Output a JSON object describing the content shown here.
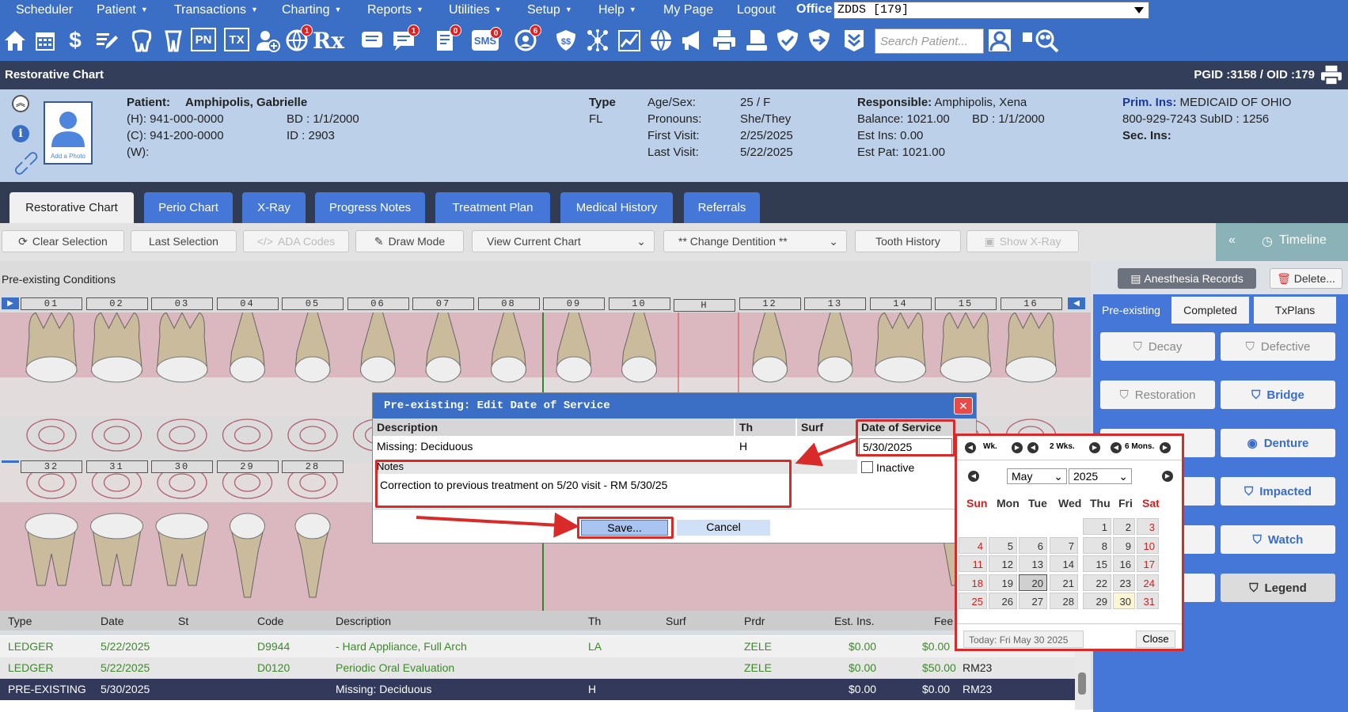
{
  "menu": [
    {
      "label": "Scheduler",
      "dd": false
    },
    {
      "label": "Patient",
      "dd": true
    },
    {
      "label": "Transactions",
      "dd": true
    },
    {
      "label": "Charting",
      "dd": true
    },
    {
      "label": "Reports",
      "dd": true
    },
    {
      "label": "Utilities",
      "dd": true
    },
    {
      "label": "Setup",
      "dd": true
    },
    {
      "label": "Help",
      "dd": true
    },
    {
      "label": "My Page",
      "dd": false
    },
    {
      "label": "Logout",
      "dd": false
    }
  ],
  "office": {
    "label": "Office",
    "value": "ZDDS [179]"
  },
  "toolbar_icons": {
    "badges": {
      "globe": "1",
      "messages": "1",
      "clipboard": "0",
      "sms": "0",
      "recall": "6"
    },
    "pn": "PN",
    "tx": "TX",
    "rx": "Rx",
    "sms": "SMS"
  },
  "search": {
    "placeholder": "Search Patient..."
  },
  "title": {
    "left": "Restorative Chart",
    "right": "PGID :3158  /  OID :179"
  },
  "patient": {
    "label": "Patient:",
    "name": "Amphipolis, Gabrielle",
    "home": "(H):  941-000-0000",
    "cell": "(C):  941-200-0000",
    "work": "(W):",
    "bd": "BD  :  1/1/2000",
    "id": "ID  :  2903",
    "photo_caption": "Add a Photo",
    "type_label": "Type",
    "type_value": "FL",
    "age_label": "Age/Sex:",
    "age_value": "25 / F",
    "pronouns_label": "Pronouns:",
    "pronouns_value": "She/They",
    "first_label": "First Visit:",
    "first_value": "2/25/2025",
    "last_label": "Last Visit:",
    "last_value": "5/22/2025"
  },
  "responsible": {
    "label": "Responsible:",
    "name": "Amphipolis, Xena",
    "balance": "Balance:  1021.00",
    "bd": "BD  :  1/1/2000",
    "est_ins": "Est Ins:   0.00",
    "est_pat": "Est Pat:  1021.00"
  },
  "insurance": {
    "prim_label": "Prim. Ins:",
    "prim_value": "MEDICAID OF OHIO",
    "phone": "800-929-7243  SubID : 1256",
    "sec_label": "Sec. Ins:"
  },
  "tabs": [
    "Restorative Chart",
    "Perio Chart",
    "X-Ray",
    "Progress Notes",
    "Treatment Plan",
    "Medical History",
    "Referrals"
  ],
  "toolbar": {
    "clear": "Clear Selection",
    "last": "Last Selection",
    "ada": "ADA Codes",
    "draw": "Draw Mode",
    "view": "View Current Chart",
    "dent": "** Change Dentition **",
    "history": "Tooth History",
    "xray": "Show X-Ray",
    "timeline": "Timeline"
  },
  "chart": {
    "section": "Pre-existing Conditions",
    "upper": [
      "01",
      "02",
      "03",
      "04",
      "05",
      "06",
      "07",
      "08",
      "09",
      "10",
      "H",
      "12",
      "13",
      "14",
      "15",
      "16"
    ],
    "lower": [
      "32",
      "31",
      "30",
      "29",
      "28"
    ]
  },
  "right": {
    "anesthesia": "Anesthesia Records",
    "delete": "Delete...",
    "tabs": [
      "Pre-existing",
      "Completed",
      "TxPlans"
    ],
    "buttons": [
      "Decay",
      "Defective",
      "Restoration",
      "Bridge",
      "Denture",
      "Impacted",
      "Watch",
      "Legend"
    ]
  },
  "grid": {
    "headers": [
      "Type",
      "Date",
      "St",
      "Code",
      "Description",
      "Th",
      "Surf",
      "Prdr",
      "Est. Ins.",
      "Fee"
    ],
    "rows": [
      {
        "type": "LEDGER",
        "date": "5/22/2025",
        "st": "",
        "code": "D9944",
        "desc": "- Hard Appliance, Full Arch",
        "th": "LA",
        "surf": "",
        "prdr": "ZELE",
        "ins": "$0.00",
        "fee": "$0.00",
        "by": ""
      },
      {
        "type": "LEDGER",
        "date": "5/22/2025",
        "st": "",
        "code": "D0120",
        "desc": "Periodic Oral Evaluation",
        "th": "",
        "surf": "",
        "prdr": "ZELE",
        "ins": "$0.00",
        "fee": "$50.00",
        "by": "RM23"
      },
      {
        "type": "PRE-EXISTING",
        "date": "5/30/2025",
        "st": "",
        "code": "",
        "desc": "Missing: Deciduous",
        "th": "H",
        "surf": "",
        "prdr": "",
        "ins": "$0.00",
        "fee": "$0.00",
        "by": "RM23"
      }
    ]
  },
  "dialog": {
    "title": "Pre-existing: Edit Date of Service",
    "h_desc": "Description",
    "h_th": "Th",
    "h_surf": "Surf",
    "h_dos": "Date of Service",
    "desc": "Missing: Deciduous",
    "th": "H",
    "dos": "5/30/2025",
    "notes_label": "Notes",
    "notes": "Correction to previous treatment on 5/20 visit - RM 5/30/25",
    "inactive": "Inactive",
    "save": "Save...",
    "cancel": "Cancel"
  },
  "calendar": {
    "wk": "Wk.",
    "wk2": "2 Wks.",
    "mons": "6 Mons.",
    "month": "May",
    "year": "2025",
    "dows": [
      "Sun",
      "Mon",
      "Tue",
      "Wed",
      "Thu",
      "Fri",
      "Sat"
    ],
    "weeks": [
      [
        "",
        "",
        "",
        "",
        "1",
        "2",
        "3"
      ],
      [
        "4",
        "5",
        "6",
        "7",
        "8",
        "9",
        "10"
      ],
      [
        "11",
        "12",
        "13",
        "14",
        "15",
        "16",
        "17"
      ],
      [
        "18",
        "19",
        "20",
        "21",
        "22",
        "23",
        "24"
      ],
      [
        "25",
        "26",
        "27",
        "28",
        "29",
        "30",
        "31"
      ]
    ],
    "today": "Today: Fri May 30 2025",
    "close": "Close"
  }
}
